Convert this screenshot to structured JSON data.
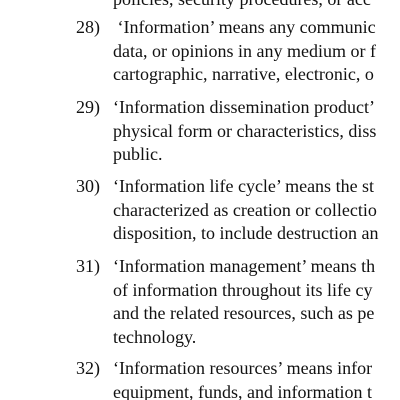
{
  "document": {
    "partial_top_line": "policies, security procedures, or acc",
    "entries": [
      {
        "number": "28)",
        "lines": [
          " ‘Information’ means any communic",
          "data, or opinions in any medium or f",
          "cartographic, narrative, electronic, o"
        ]
      },
      {
        "number": "29)",
        "lines": [
          "‘Information dissemination product’",
          "physical form or characteristics, diss",
          "public."
        ]
      },
      {
        "number": "30)",
        "lines": [
          "‘Information life cycle’ means the st",
          "characterized as creation or collectio",
          "disposition, to include destruction an"
        ]
      },
      {
        "number": "31)",
        "lines": [
          "‘Information management’ means th",
          "of information throughout its life cy",
          "and the related resources, such as pe",
          "technology."
        ]
      },
      {
        "number": "32)",
        "lines": [
          "‘Information resources’ means infor",
          "equipment, funds, and information t"
        ]
      }
    ]
  }
}
